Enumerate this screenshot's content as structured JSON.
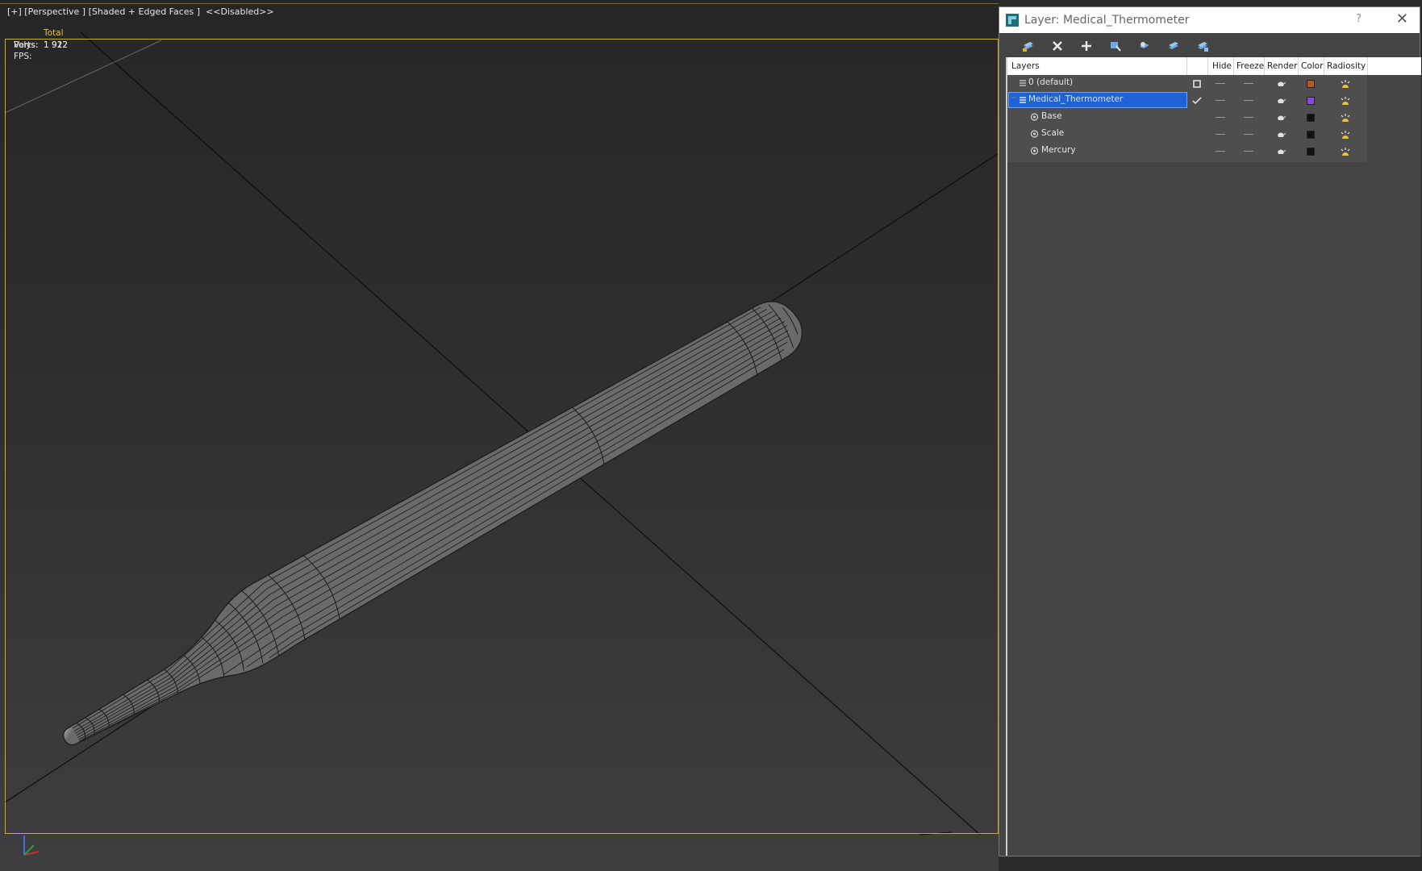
{
  "viewport": {
    "label": "[+] [Perspective ] [Shaded + Edged Faces ]  <<Disabled>>",
    "stats": {
      "header": "Total",
      "polys_label": "Polys:",
      "polys_value": "1 912",
      "verts_label": "Verts:",
      "verts_value": "1 922",
      "fps_label": "FPS:"
    }
  },
  "layer_panel": {
    "title": "Layer: Medical_Thermometer",
    "help": "?",
    "toolbar_icons": [
      "create-layer-icon",
      "delete-layer-icon",
      "add-selection-icon",
      "select-objects-icon",
      "highlight-layer-icon",
      "hide-all-icon",
      "freeze-all-icon"
    ],
    "columns": {
      "layers": "Layers",
      "hide": "Hide",
      "freeze": "Freeze",
      "render": "Render",
      "color": "Color",
      "radiosity": "Radiosity"
    },
    "rows": [
      {
        "name": "0 (default)",
        "type": "layer",
        "current": false,
        "color": "#c0561f"
      },
      {
        "name": "Medical_Thermometer",
        "type": "layer",
        "current": true,
        "selected": true,
        "color": "#8a4ae0"
      },
      {
        "name": "Base",
        "type": "object",
        "color": "#111111"
      },
      {
        "name": "Scale",
        "type": "object",
        "color": "#111111"
      },
      {
        "name": "Mercury",
        "type": "object",
        "color": "#111111"
      }
    ]
  }
}
